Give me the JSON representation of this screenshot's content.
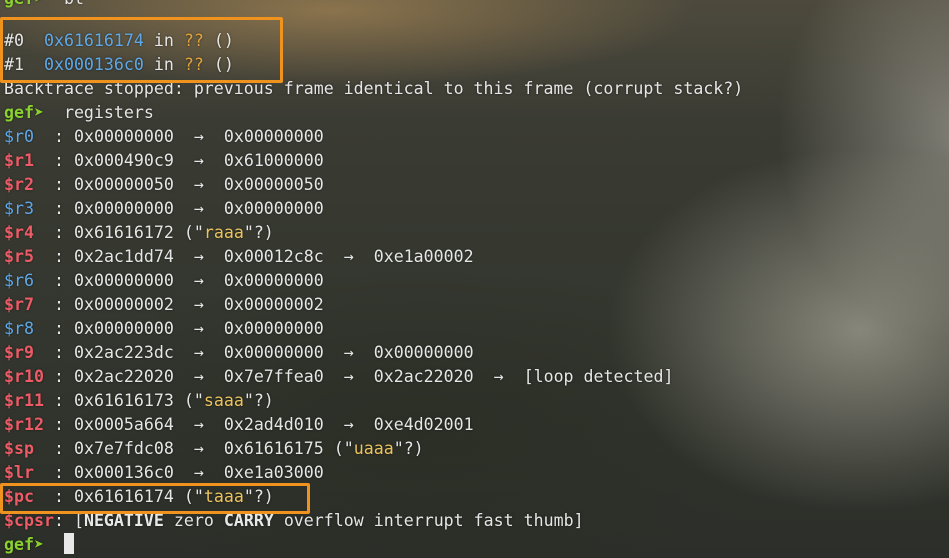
{
  "terminal": {
    "prompt": "gef➤",
    "top_cut_text": "gef➤  bt",
    "cmd_bt": "bt",
    "frames": [
      {
        "index": "#0",
        "addr": "0x61616174",
        "in": "in",
        "unk": "??",
        "args": "()"
      },
      {
        "index": "#1",
        "addr": "0x000136c0",
        "in": "in",
        "unk": "??",
        "args": "()"
      }
    ],
    "backtrace_msg": "Backtrace stopped: previous frame identical to this frame (corrupt stack?)",
    "cmd_registers": "registers",
    "arrow": "→",
    "registers": {
      "r0": {
        "name": "$r0",
        "sep": ":",
        "value": "0x00000000",
        "deref1": "0x00000000"
      },
      "r1": {
        "name": "$r1",
        "sep": ":",
        "value": "0x000490c9",
        "deref1": "0x61000000"
      },
      "r2": {
        "name": "$r2",
        "sep": ":",
        "value": "0x00000050",
        "deref1": "0x00000050"
      },
      "r3": {
        "name": "$r3",
        "sep": ":",
        "value": "0x00000000",
        "deref1": "0x00000000"
      },
      "r4": {
        "name": "$r4",
        "sep": ":",
        "value": "0x61616172",
        "str_open": "(\"",
        "str": "raaa",
        "str_close": "\"?)"
      },
      "r5": {
        "name": "$r5",
        "sep": ":",
        "value": "0x2ac1dd74",
        "deref1": "0x00012c8c",
        "deref2": "0xe1a00002"
      },
      "r6": {
        "name": "$r6",
        "sep": ":",
        "value": "0x00000000",
        "deref1": "0x00000000"
      },
      "r7": {
        "name": "$r7",
        "sep": ":",
        "value": "0x00000002",
        "deref1": "0x00000002"
      },
      "r8": {
        "name": "$r8",
        "sep": ":",
        "value": "0x00000000",
        "deref1": "0x00000000"
      },
      "r9": {
        "name": "$r9",
        "sep": ":",
        "value": "0x2ac223dc",
        "deref1": "0x00000000",
        "deref2": "0x00000000"
      },
      "r10": {
        "name": "$r10",
        "sep": ":",
        "value": "0x2ac22020",
        "deref1": "0x7e7ffea0",
        "deref2": "0x2ac22020",
        "loop": "[loop detected]"
      },
      "r11": {
        "name": "$r11",
        "sep": ":",
        "value": "0x61616173",
        "str_open": "(\"",
        "str": "saaa",
        "str_close": "\"?)"
      },
      "r12": {
        "name": "$r12",
        "sep": ":",
        "value": "0x0005a664",
        "deref1": "0x2ad4d010",
        "deref2": "0xe4d02001"
      },
      "sp": {
        "name": "$sp",
        "sep": ":",
        "value": "0x7e7fdc08",
        "deref1": "0x61616175",
        "str_open": "(\"",
        "str": "uaaa",
        "str_close": "\"?)"
      },
      "lr": {
        "name": "$lr",
        "sep": ":",
        "value": "0x000136c0",
        "deref1": "0xe1a03000"
      },
      "pc": {
        "name": "$pc",
        "sep": ":",
        "value": "0x61616174",
        "str_open": "(\"",
        "str": "taaa",
        "str_close": "\"?)"
      },
      "cpsr": {
        "name": "$cpsr",
        "sep": ":",
        "open": "[",
        "flag_negative": "NEGATIVE",
        "flag_zero": "zero",
        "flag_carry": "CARRY",
        "flag_overflow": "overflow",
        "flag_interrupt": "interrupt",
        "flag_fast": "fast",
        "flag_thumb": "thumb",
        "close": "]"
      }
    }
  },
  "colors": {
    "highlight_box": "#f0921e",
    "prompt": "#8ad02e",
    "address_blue": "#5fa8e8",
    "register_red": "#ec5b66",
    "string_yellow": "#ecc45e"
  }
}
